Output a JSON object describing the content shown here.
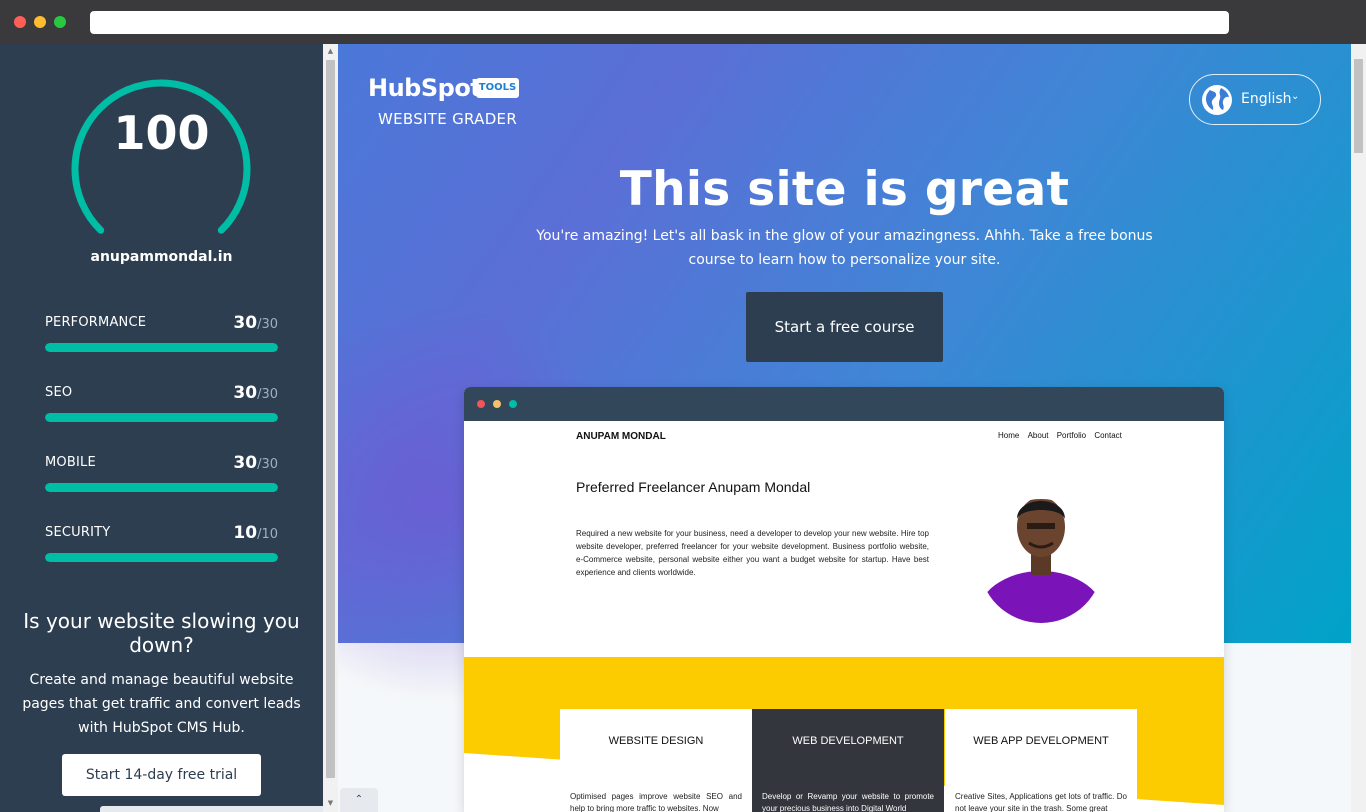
{
  "sidebar": {
    "score": "100",
    "score_fraction": 1.0,
    "domain": "anupammondal.in",
    "metrics": [
      {
        "label": "PERFORMANCE",
        "score": "30",
        "max": "/30",
        "fill": 1.0
      },
      {
        "label": "SEO",
        "score": "30",
        "max": "/30",
        "fill": 1.0
      },
      {
        "label": "MOBILE",
        "score": "30",
        "max": "/30",
        "fill": 1.0
      },
      {
        "label": "SECURITY",
        "score": "10",
        "max": "/10",
        "fill": 1.0
      }
    ],
    "promo_title": "Is your website slowing you down?",
    "promo_text": "Create and manage beautiful website pages that get traffic and convert leads with HubSpot CMS Hub.",
    "trial_button": "Start 14-day free trial"
  },
  "header": {
    "logo_text": "HubSpot",
    "logo_badge": "TOOLS",
    "product_name": "WEBSITE GRADER",
    "language": "English",
    "chevron": "⌄"
  },
  "hero": {
    "headline": "This site is great",
    "subtext": "You're amazing! Let's all bask in the glow of your amazingness. Ahhh. Take a free bonus course to learn how to personalize your site.",
    "course_button": "Start a free course"
  },
  "preview": {
    "brand": "ANUPAM MONDAL",
    "nav": [
      "Home",
      "About",
      "Portfolio",
      "Contact"
    ],
    "title": "Preferred Freelancer Anupam Mondal",
    "description": "Required a new website for your business, need a developer to develop your new website. Hire top website developer, preferred freelancer for your website development. Business portfolio website, e-Commerce website, personal website either you want a budget website for startup. Have best experience and clients worldwide.",
    "services": [
      {
        "title": "WEBSITE DESIGN",
        "desc": "Optimised pages improve website SEO and help to bring more traffic to websites. Now"
      },
      {
        "title": "WEB DEVELOPMENT",
        "desc": "Develop or Revamp your website to promote your precious business into Digital World"
      },
      {
        "title": "WEB APP DEVELOPMENT",
        "desc": "Creative Sites, Applications get lots of traffic. Do not leave your site in the trash. Some great"
      }
    ]
  },
  "ui": {
    "collapse_icon": "⌃",
    "scroll_up": "▲",
    "scroll_down": "▼"
  },
  "colors": {
    "accent": "#00bda5",
    "sidebar_bg": "#2d3e50",
    "preview_yellow": "#fccb00"
  }
}
